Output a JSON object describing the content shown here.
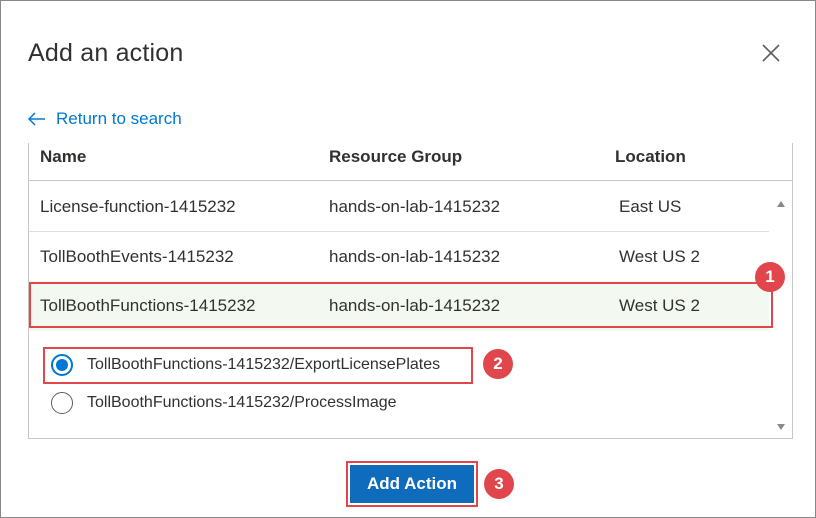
{
  "dialog": {
    "title": "Add an action",
    "close_icon": "close-icon",
    "back_link": "Return to search",
    "back_icon": "arrow-left-icon"
  },
  "table": {
    "columns": [
      "Name",
      "Resource Group",
      "Location"
    ],
    "rows": [
      {
        "name": "License-function-1415232",
        "group": "hands-on-lab-1415232",
        "location": "East US"
      },
      {
        "name": "TollBoothEvents-1415232",
        "group": "hands-on-lab-1415232",
        "location": "West US 2"
      },
      {
        "name": "TollBoothFunctions-1415232",
        "group": "hands-on-lab-1415232",
        "location": "West US 2"
      }
    ],
    "selected_row": 2
  },
  "functions": [
    {
      "label": "TollBoothFunctions-1415232/ExportLicensePlates",
      "checked": true
    },
    {
      "label": "TollBoothFunctions-1415232/ProcessImage",
      "checked": false
    }
  ],
  "callouts": [
    "1",
    "2",
    "3"
  ],
  "actions": {
    "add_label": "Add Action"
  },
  "colors": {
    "accent": "#0078d4",
    "button": "#0f6cbd",
    "callout": "#e0464b",
    "selected_row_bg": "#f3f9f1"
  }
}
